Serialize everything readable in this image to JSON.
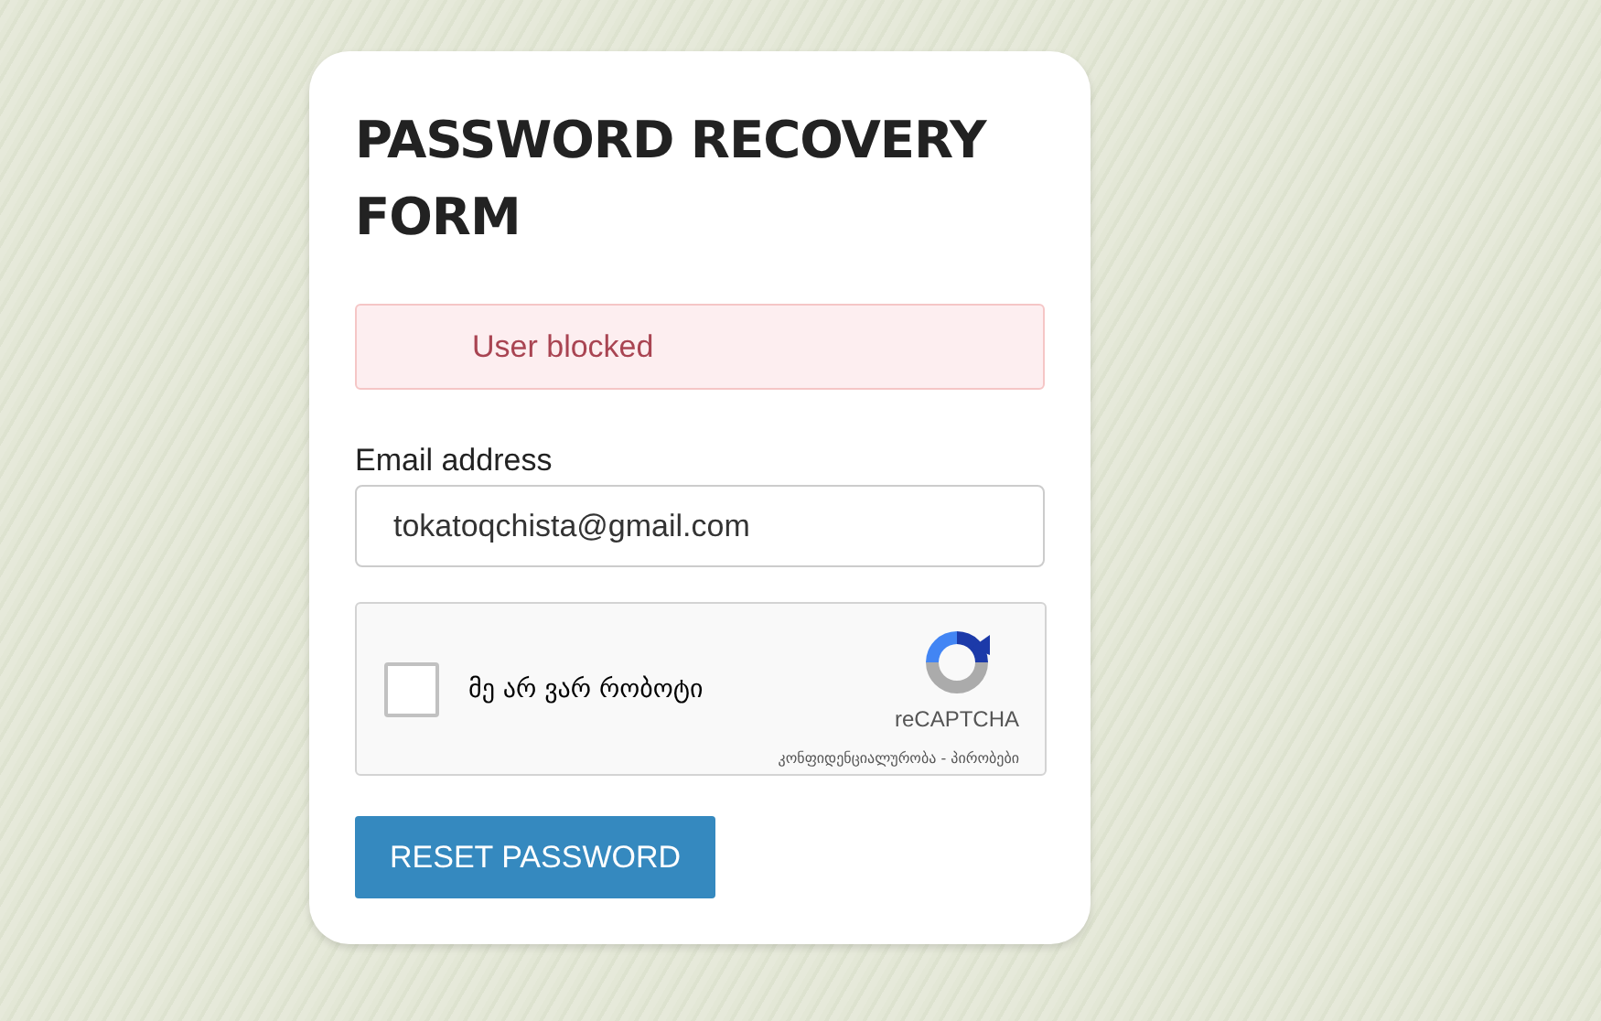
{
  "form": {
    "title": "PASSWORD RECOVERY FORM",
    "alert": {
      "kind": "error",
      "message": "User blocked"
    },
    "email": {
      "label": "Email address",
      "value": "tokatoqchista@gmail.com"
    },
    "captcha": {
      "checked": false,
      "label": "მე არ ვარ რობოტი",
      "brand": "reCAPTCHA",
      "footer": "კონფიდენციალურობა - პირობები"
    },
    "submit": {
      "label": "RESET PASSWORD"
    }
  }
}
